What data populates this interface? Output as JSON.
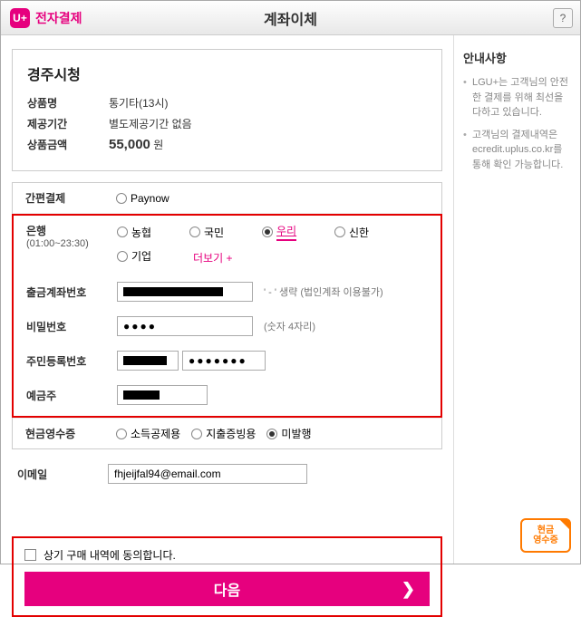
{
  "brand": "전자결제",
  "title": "계좌이체",
  "help": "?",
  "merchant": "경주시청",
  "product": {
    "label": "상품명",
    "value": "통기타(13시)"
  },
  "period": {
    "label": "제공기간",
    "value": "별도제공기간 없음"
  },
  "amount": {
    "label": "상품금액",
    "value": "55,000",
    "unit": "원"
  },
  "easypay": {
    "label": "간편결제",
    "option": "Paynow"
  },
  "bank": {
    "label": "은행",
    "hours": "(01:00~23:30)",
    "options": [
      "농협",
      "국민",
      "우리",
      "신한",
      "기업"
    ],
    "selected": "우리",
    "more": "더보기 +"
  },
  "account": {
    "label": "출금계좌번호",
    "hint": "' - ' 생략 (법인계좌 이용불가)"
  },
  "password": {
    "label": "비밀번호",
    "hint": "(숫자 4자리)",
    "dots": "●●●●"
  },
  "ssn": {
    "label": "주민등록번호",
    "dots": "●●●●●●●"
  },
  "holder": {
    "label": "예금주"
  },
  "receipt": {
    "label": "현금영수증",
    "options": [
      "소득공제용",
      "지출증빙용",
      "미발행"
    ],
    "selected": "미발행"
  },
  "email": {
    "label": "이메일",
    "value": "fhjeijfal94@email.com"
  },
  "agree": "상기 구매 내역에 동의합니다.",
  "next": "다음",
  "side": {
    "title": "안내사항",
    "items": [
      "LGU+는 고객님의 안전한 결제를 위해 최선을 다하고 있습니다.",
      "고객님의 결제내역은 ecredit.uplus.co.kr를 통해 확인 가능합니다."
    ]
  },
  "receipt_badge": {
    "l1": "현금",
    "l2": "영수증"
  }
}
